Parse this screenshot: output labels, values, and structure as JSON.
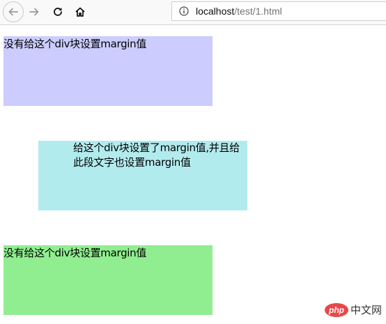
{
  "browser": {
    "url_host": "localhost",
    "url_path": "/test/1.html",
    "icons": [
      "back-arrow-icon",
      "forward-arrow-icon",
      "reload-icon",
      "home-icon",
      "info-icon"
    ]
  },
  "page": {
    "block1_text": "没有给这个div块设置margin值",
    "block2_text": "给这个div块设置了margin值,并且给此段文字也设置margin值",
    "block3_text": "没有给这个div块设置margin值",
    "colors": {
      "block1": "#ccccff",
      "block2": "#b2ebee",
      "block3": "#90ee90"
    }
  },
  "watermark": {
    "logo": "php",
    "text": "中文网"
  }
}
